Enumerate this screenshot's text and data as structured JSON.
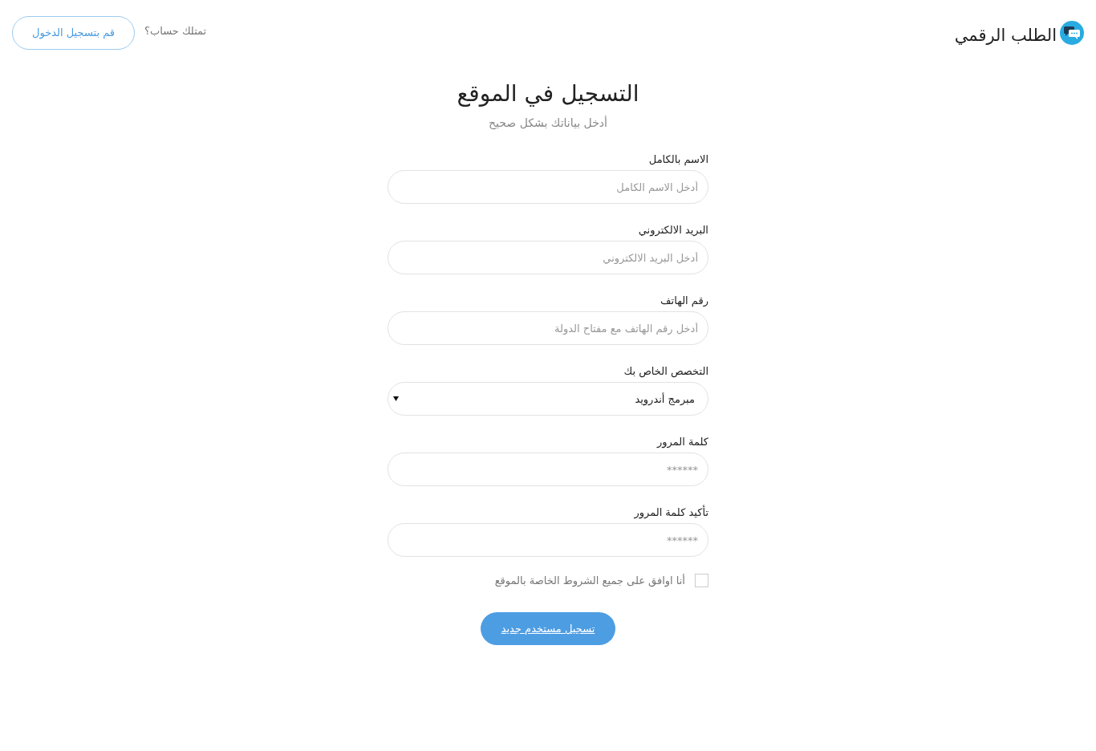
{
  "header": {
    "brand": "الطلب الرقمي",
    "login_prompt": "تمتلك حساب؟",
    "login_button": "قم بتسجيل الدخول"
  },
  "title": "التسجيل في الموقع",
  "subtitle": "أدخل بياناتك بشكل صحيح",
  "fields": [
    {
      "kind": "text",
      "label": "الاسم بالكامل",
      "placeholder": "أدخل الاسم الكامل"
    },
    {
      "kind": "text",
      "label": "البريد الالكتروني",
      "placeholder": "أدخل البريد الالكتروني"
    },
    {
      "kind": "text",
      "label": "رقم الهاتف",
      "placeholder": "أدخل رقم الهاتف مع مفتاح الدولة"
    },
    {
      "kind": "select",
      "label": "التخصص الخاص بك",
      "value": "مبرمج أندرويد"
    },
    {
      "kind": "password",
      "label": "كلمة المرور",
      "placeholder": "******"
    },
    {
      "kind": "password",
      "label": "تأكيد كلمة المرور",
      "placeholder": "******"
    }
  ],
  "terms": {
    "label": "أنا اوافق على جميع الشروط الخاصة بالموقع",
    "checked": false
  },
  "submit": "تسجيل مستخدم جديد"
}
